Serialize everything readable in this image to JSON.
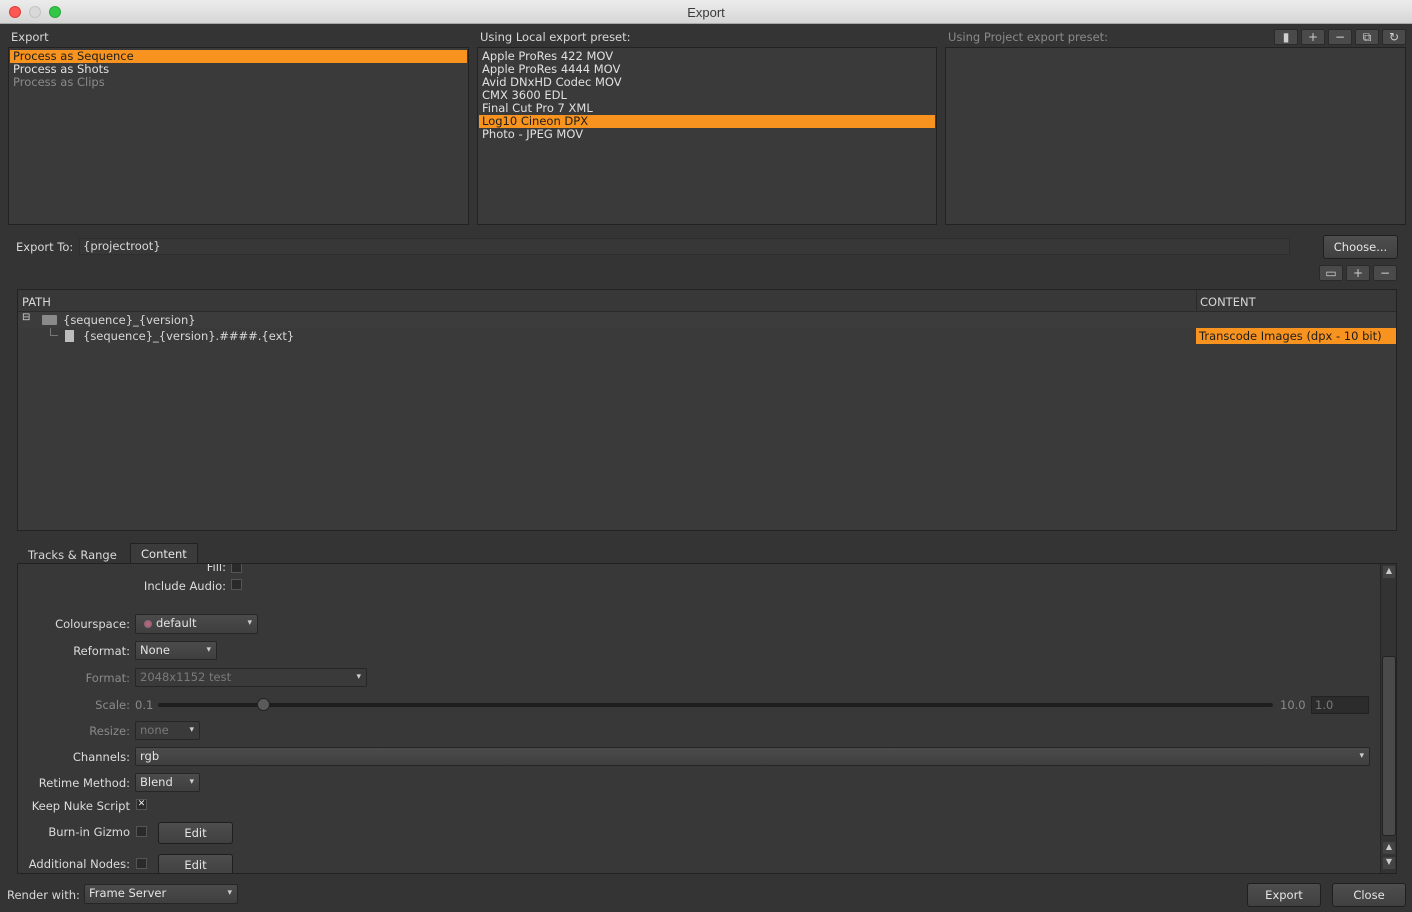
{
  "window": {
    "title": "Export"
  },
  "export_panel": {
    "heading": "Export",
    "items": [
      "Process as Sequence",
      "Process as Shots",
      "Process as Clips"
    ]
  },
  "local_preset": {
    "heading": "Using Local export preset:",
    "items": [
      "Apple ProRes 422 MOV",
      "Apple ProRes 4444 MOV",
      "Avid DNxHD Codec MOV",
      "CMX 3600 EDL",
      "Final Cut Pro 7 XML",
      "Log10 Cineon DPX",
      "Photo - JPEG MOV"
    ]
  },
  "project_preset": {
    "heading": "Using Project export preset:"
  },
  "export_to": {
    "label": "Export To:",
    "value": "{projectroot}",
    "choose_label": "Choose..."
  },
  "tree": {
    "col_path": "PATH",
    "col_content": "CONTENT",
    "folder": "{sequence}_{version}",
    "file": "{sequence}_{version}.####.{ext}",
    "file_content": "Transcode Images (dpx - 10 bit)"
  },
  "tabs": [
    "Tracks & Range",
    "Content"
  ],
  "settings": {
    "fill_label": "Fill:",
    "include_audio_label": "Include Audio:",
    "colourspace_label": "Colourspace:",
    "colourspace_value": "default",
    "reformat_label": "Reformat:",
    "reformat_value": "None",
    "format_label": "Format:",
    "format_value": "2048x1152 test",
    "scale_label": "Scale:",
    "scale_min": "0.1",
    "scale_max": "10.0",
    "scale_value": "1.0",
    "resize_label": "Resize:",
    "resize_value": "none",
    "channels_label": "Channels:",
    "channels_value": "rgb",
    "retime_label": "Retime Method:",
    "retime_value": "Blend",
    "keep_nuke_label": "Keep Nuke Script",
    "burnin_label": "Burn-in Gizmo",
    "burnin_edit": "Edit",
    "additional_label": "Additional Nodes:",
    "additional_edit": "Edit"
  },
  "footer": {
    "render_label": "Render with:",
    "render_value": "Frame Server",
    "export_label": "Export",
    "close_label": "Close"
  },
  "colors": {
    "selection": "#f7931e",
    "background": "#343434"
  }
}
